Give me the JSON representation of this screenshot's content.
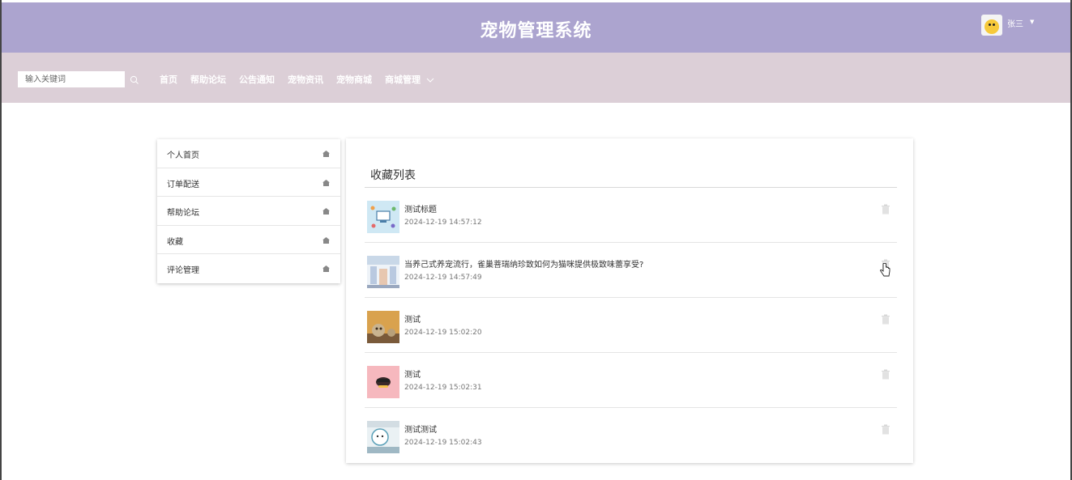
{
  "header": {
    "title": "宠物管理系统",
    "user_name": "张三",
    "user_avatar_icon": "duck-avatar-icon"
  },
  "navbar": {
    "search_placeholder": "输入关键词",
    "search_icon": "search-icon",
    "links": [
      "首页",
      "帮助论坛",
      "公告通知",
      "宠物资讯",
      "宠物商城",
      "商城管理"
    ],
    "dropdown_icon": "chevron-down-icon"
  },
  "sidebar": {
    "items": [
      {
        "label": "个人首页",
        "icon": "home-icon"
      },
      {
        "label": "订单配送",
        "icon": "home-icon"
      },
      {
        "label": "帮助论坛",
        "icon": "home-icon"
      },
      {
        "label": "收藏",
        "icon": "home-icon"
      },
      {
        "label": "评论管理",
        "icon": "home-icon"
      }
    ]
  },
  "favorites": {
    "title": "收藏列表",
    "delete_icon": "trash-icon",
    "items": [
      {
        "title": "测试标题",
        "time": "2024-12-19 14:57:12",
        "thumb": "illustration-thumb"
      },
      {
        "title": "当养己式养宠流行，雀巢菩瑞纳珍致如何为猫咪提供极致味蕾享受?",
        "time": "2024-12-19 14:57:49",
        "thumb": "store-thumb"
      },
      {
        "title": "测试",
        "time": "2024-12-19 15:02:20",
        "thumb": "plush-toy-thumb"
      },
      {
        "title": "测试",
        "time": "2024-12-19 15:02:31",
        "thumb": "cartoon-face-thumb"
      },
      {
        "title": "测试测试",
        "time": "2024-12-19 15:02:43",
        "thumb": "dog-thumb"
      }
    ]
  },
  "colors": {
    "header_bg": "#aca4cf",
    "navbar_bg": "#dccfd7",
    "text": "#333333"
  }
}
